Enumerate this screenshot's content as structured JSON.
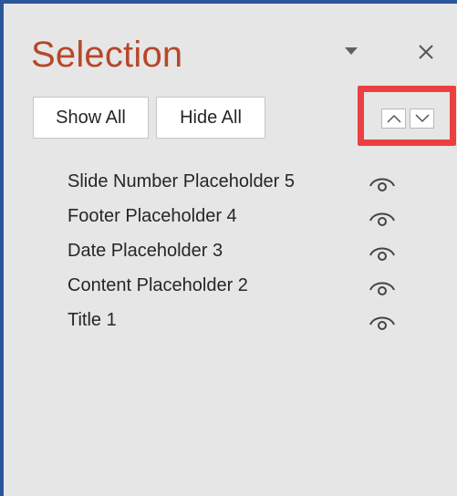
{
  "pane": {
    "title": "Selection"
  },
  "buttons": {
    "show_all": "Show All",
    "hide_all": "Hide All"
  },
  "objects": [
    {
      "label": "Slide Number Placeholder 5",
      "visible": true
    },
    {
      "label": "Footer Placeholder 4",
      "visible": true
    },
    {
      "label": "Date Placeholder 3",
      "visible": true
    },
    {
      "label": "Content Placeholder 2",
      "visible": true
    },
    {
      "label": "Title 1",
      "visible": true
    }
  ],
  "icons": {
    "options": "chevron-down-icon",
    "close": "close-icon",
    "bring_forward": "chevron-up-icon",
    "send_backward": "chevron-down-icon",
    "visibility": "eye-icon"
  },
  "colors": {
    "title": "#b7472a",
    "highlight": "#ec4040",
    "frame_border": "#2b579a",
    "background": "#e6e6e6"
  }
}
